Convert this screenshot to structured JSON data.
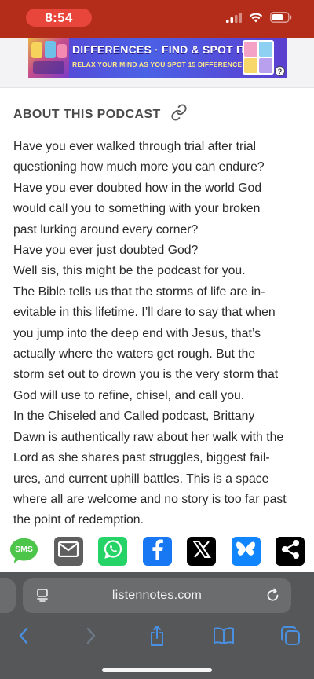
{
  "status_bar": {
    "time": "8:54",
    "bar_color": "#b32d1a",
    "pill_color": "#e8463a",
    "icons": [
      "signal-icon",
      "wifi-icon",
      "battery-icon"
    ]
  },
  "ad": {
    "title": "DIFFERENCES · FIND & SPOT IT",
    "subtitle": "RELAX YOUR MIND AS YOU SPOT 15 DIFFERENCES!",
    "help_label": "?"
  },
  "about": {
    "title": "ABOUT THIS PODCAST",
    "link_icon": "link-icon"
  },
  "description": {
    "lines": [
      "Have you ever walked through trial after trial",
      "questioning how much more you can endure?",
      "Have you ever doubted how in the world God",
      "would call you to something with your broken",
      "past lurking around every corner?",
      "Have you ever just doubted God?",
      "Well sis, this might be the podcast for you.",
      "The Bible tells us that the storms of life are in-",
      "evitable in this lifetime. I’ll dare to say that when",
      "you jump into the deep end with Jesus, that’s",
      "actually where the waters get rough. But the",
      "storm set out to drown you is the very storm that",
      "God will use to refine, chisel, and call you.",
      "In the Chiseled and Called podcast, Brittany",
      "Dawn is authentically raw about her walk with the",
      "Lord as she shares past struggles, biggest fail-",
      "ures, and current uphill battles. This is a space",
      "where all are welcome and no story is too far past",
      "the point of redemption."
    ]
  },
  "share": {
    "sms_label": "SMS",
    "buttons": [
      {
        "name": "sms",
        "color": "#4cc54a"
      },
      {
        "name": "email",
        "color": "#5f5f5f"
      },
      {
        "name": "whatsapp",
        "color": "#25d366"
      },
      {
        "name": "facebook",
        "color": "#1877f2"
      },
      {
        "name": "x",
        "color": "#000000"
      },
      {
        "name": "bluesky",
        "color": "#1185fe"
      },
      {
        "name": "share",
        "color": "#000000"
      }
    ]
  },
  "browser": {
    "url": "listennotes.com",
    "toolbar_icons": [
      "back-icon",
      "forward-icon",
      "share-icon",
      "bookmarks-icon",
      "tabs-icon"
    ],
    "accent": "#4a90e2"
  }
}
